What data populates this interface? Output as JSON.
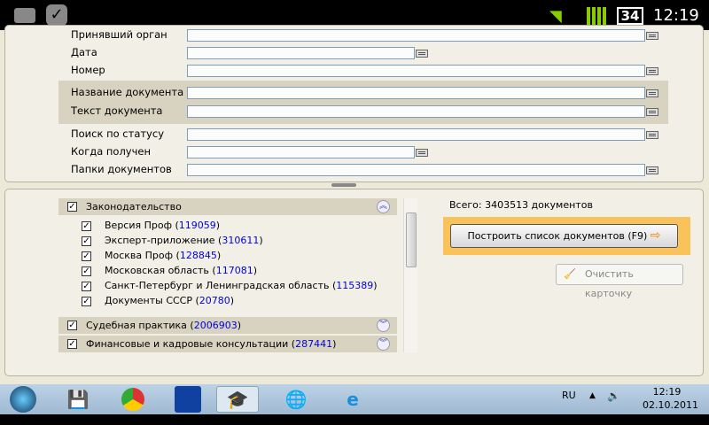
{
  "statusbar": {
    "battery": "34",
    "time": "12:19"
  },
  "form": {
    "fields": [
      {
        "label": "Принявший орган",
        "wide": true
      },
      {
        "label": "Дата",
        "wide": false
      },
      {
        "label": "Номер",
        "wide": true
      },
      {
        "label": "Название документа",
        "wide": true
      },
      {
        "label": "Текст документа",
        "wide": true
      },
      {
        "label": "Поиск по статусу",
        "wide": true
      },
      {
        "label": "Когда получен",
        "wide": false
      },
      {
        "label": "Папки документов",
        "wide": true
      }
    ]
  },
  "sections": {
    "legislation": {
      "label": "Законодательство",
      "items": [
        {
          "label": "Версия Проф",
          "count": "119059"
        },
        {
          "label": "Эксперт-приложение",
          "count": "310611"
        },
        {
          "label": "Москва Проф",
          "count": "128845"
        },
        {
          "label": "Московская область",
          "count": "117081"
        },
        {
          "label": "Санкт-Петербург и Ленинградская область",
          "count": "115389"
        },
        {
          "label": "Документы СССР",
          "count": "20780"
        }
      ]
    },
    "court": {
      "label": "Судебная практика",
      "count": "2006903"
    },
    "finance": {
      "label": "Финансовые и кадровые консультации",
      "count": "287441"
    }
  },
  "summary": {
    "total": "Всего: 3403513 документов",
    "build_button": "Построить список документов (F9)",
    "clear_button": "Очистить карточку"
  },
  "taskbar": {
    "lang": "RU",
    "time": "12:19",
    "date": "02.10.2011"
  },
  "colors": {
    "accent": "#f9c25a",
    "link": "#0000e0"
  }
}
